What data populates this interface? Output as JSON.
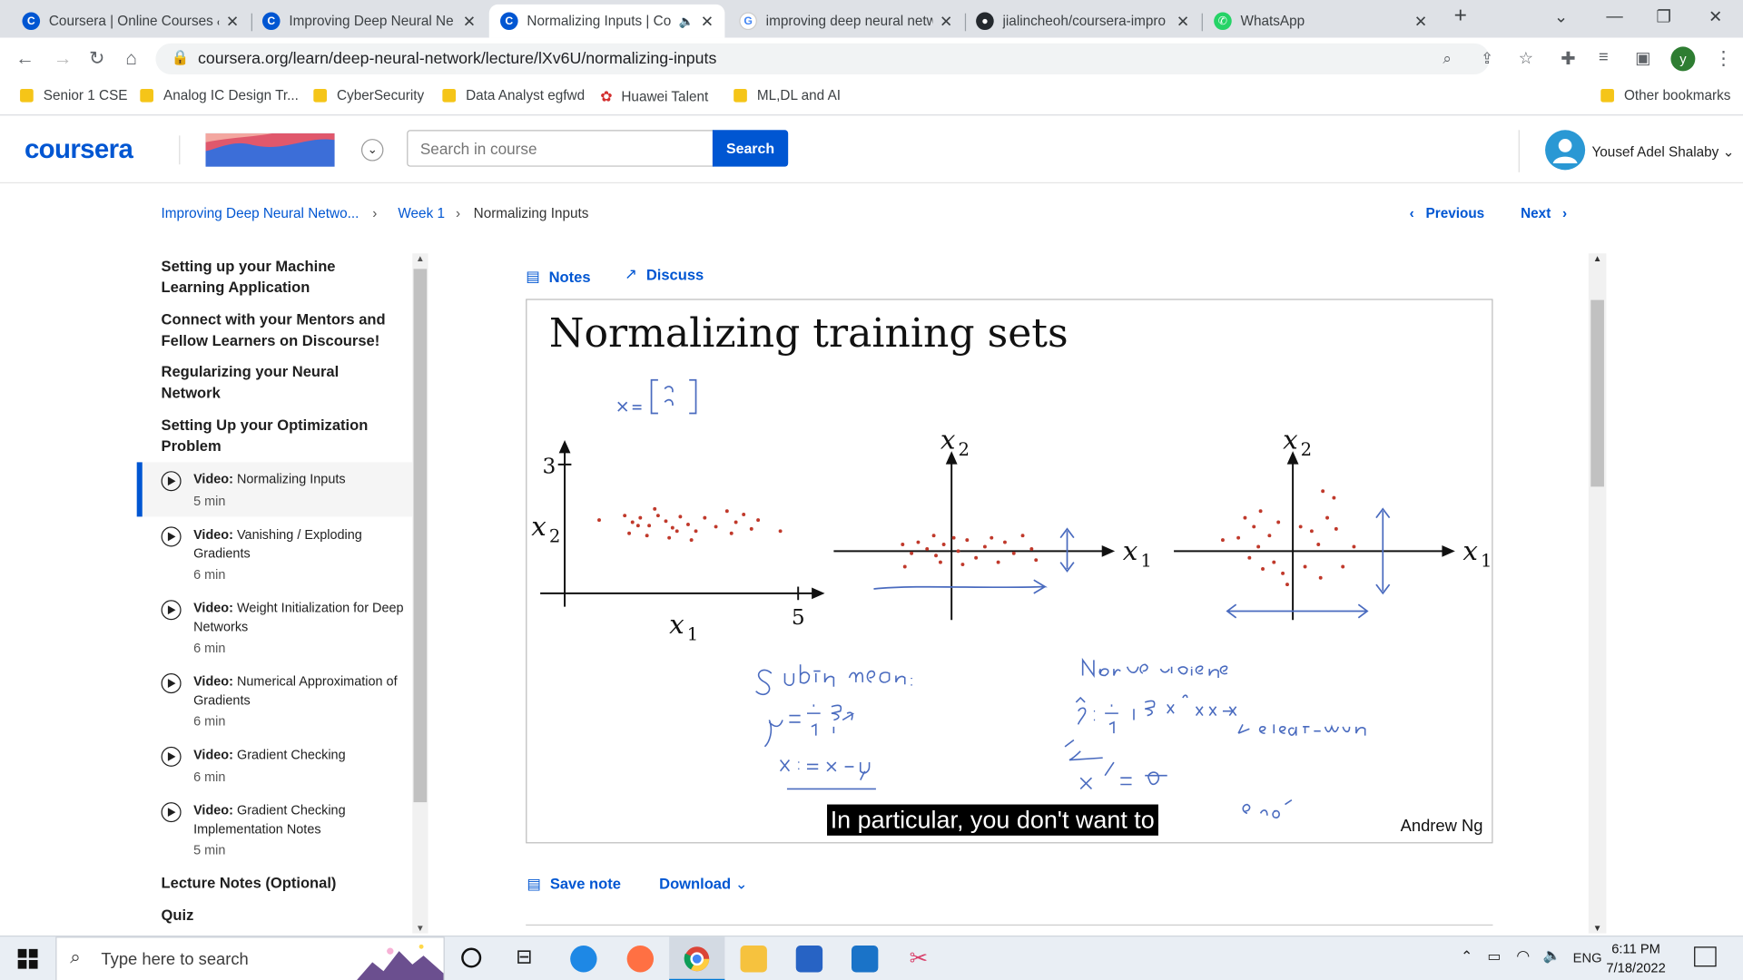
{
  "browser": {
    "tabs": [
      {
        "title": "Coursera | Online Courses &",
        "icon": "coursera-icon"
      },
      {
        "title": "Improving Deep Neural Ne",
        "icon": "coursera-icon"
      },
      {
        "title": "Normalizing Inputs | Co",
        "icon": "coursera-icon",
        "active": true
      },
      {
        "title": "improving deep neural netw",
        "icon": "google-icon"
      },
      {
        "title": "jialincheoh/coursera-impro",
        "icon": "github-icon"
      },
      {
        "title": "WhatsApp",
        "icon": "whatsapp-icon"
      }
    ],
    "url": "coursera.org/learn/deep-neural-network/lecture/lXv6U/normalizing-inputs",
    "profile_initial": "y",
    "bookmarks": [
      "Senior 1 CSE",
      "Analog IC Design Tr...",
      "CyberSecurity",
      "Data Analyst egfwd",
      "Huawei Talent",
      "ML,DL and AI"
    ],
    "other_bookmarks": "Other bookmarks"
  },
  "header": {
    "logo": "coursera",
    "search_placeholder": "Search in course",
    "search_button": "Search",
    "user": "Yousef Adel Shalaby"
  },
  "breadcrumb": {
    "course": "Improving Deep Neural Netwo...",
    "week": "Week 1",
    "current": "Normalizing Inputs",
    "previous": "Previous",
    "next": "Next"
  },
  "sidebar": {
    "sections": [
      "Setting up your Machine Learning Application",
      "Connect with your Mentors and Fellow Learners on Discourse!",
      "Regularizing your Neural Network",
      "Setting Up your Optimization Problem"
    ],
    "videos": [
      {
        "prefix": "Video:",
        "title": "Normalizing Inputs",
        "duration": "5 min"
      },
      {
        "prefix": "Video:",
        "title": "Vanishing / Exploding Gradients",
        "duration": "6 min"
      },
      {
        "prefix": "Video:",
        "title": "Weight Initialization for Deep Networks",
        "duration": "6 min"
      },
      {
        "prefix": "Video:",
        "title": "Numerical Approximation of Gradients",
        "duration": "6 min"
      },
      {
        "prefix": "Video:",
        "title": "Gradient Checking",
        "duration": "6 min"
      },
      {
        "prefix": "Video:",
        "title": "Gradient Checking Implementation Notes",
        "duration": "5 min"
      }
    ],
    "after": [
      "Lecture Notes (Optional)",
      "Quiz"
    ]
  },
  "main": {
    "notes": "Notes",
    "discuss": "Discuss",
    "save_note": "Save note",
    "download": "Download"
  },
  "slide": {
    "title": "Normalizing training sets",
    "caption": "In particular, you don't want to",
    "author": "Andrew Ng"
  },
  "taskbar": {
    "search": "Type here to search",
    "lang": "ENG",
    "time": "6:11 PM",
    "date": "7/18/2022"
  }
}
